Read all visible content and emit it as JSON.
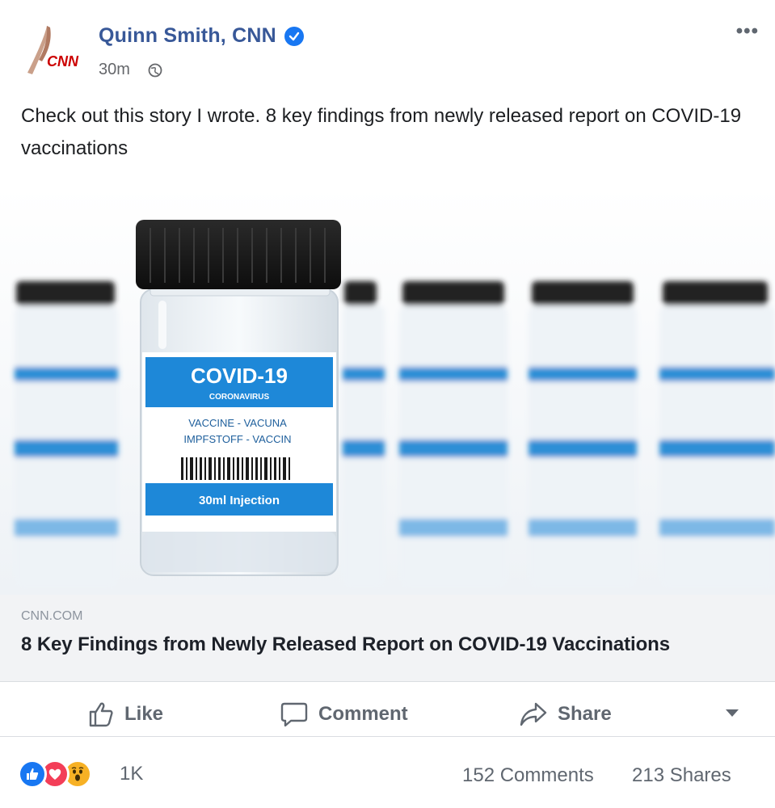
{
  "author": {
    "name": "Quinn Smith, CNN",
    "avatar_text": "CNN",
    "timestamp": "30m"
  },
  "post": {
    "text": "Check out this story I wrote. 8 key findings from newly released report on COVID-19 vaccinations"
  },
  "media": {
    "vial_label_title": "COVID-19",
    "vial_label_subtitle": "CORONAVIRUS",
    "vial_label_line1": "VACCINE - VACUNA",
    "vial_label_line2": "IMPFSTOFF - VACCIN",
    "vial_label_dose": "30ml Injection"
  },
  "link": {
    "domain": "CNN.COM",
    "title": "8 Key Findings from Newly Released Report on COVID-19 Vaccinations"
  },
  "actions": {
    "like": "Like",
    "comment": "Comment",
    "share": "Share"
  },
  "stats": {
    "reactions": "1K",
    "comments": "152 Comments",
    "shares": "213 Shares"
  },
  "icons": {
    "verified": "verified-badge-icon",
    "audience": "globe-icon",
    "more": "more-options-icon"
  },
  "colors": {
    "author_name": "#385898",
    "brand_blue": "#1877f2",
    "love_red": "#f33e58",
    "wow_yellow": "#f7b125",
    "cnn_red": "#cc0000",
    "vial_label_blue": "#1e88d8"
  }
}
